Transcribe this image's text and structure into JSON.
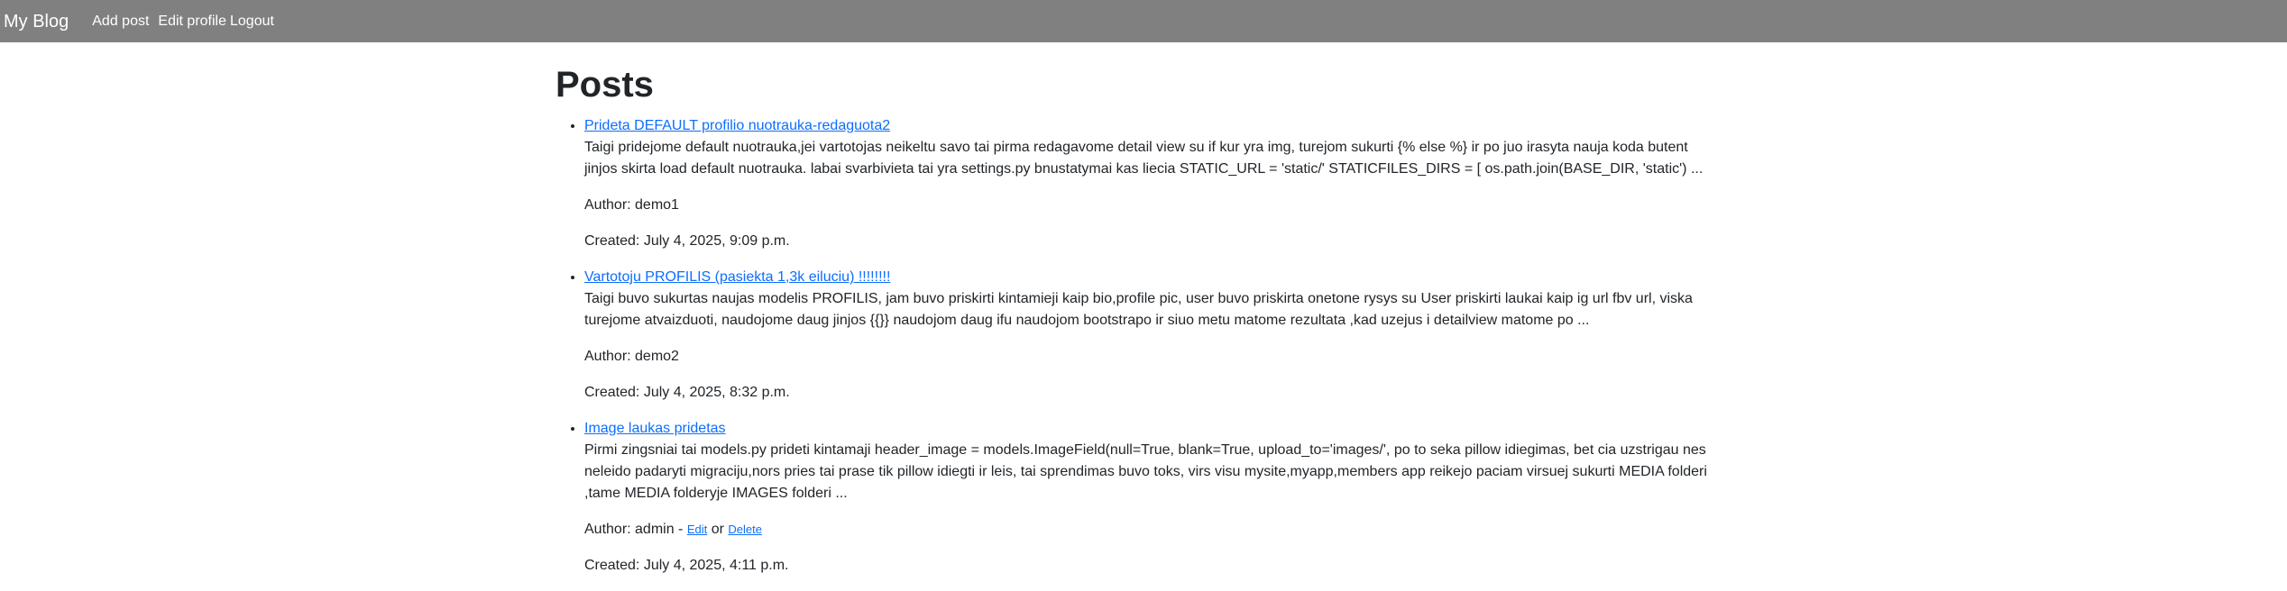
{
  "navbar": {
    "brand": "My Blog",
    "links": [
      "Add post",
      "Edit profile",
      "Logout"
    ]
  },
  "page": {
    "title": "Posts"
  },
  "posts": [
    {
      "title": "Prideta DEFAULT profilio nuotrauka-redaguota2",
      "body": "Taigi pridejome default nuotrauka,jei vartotojas neikeltu savo tai pirma redagavome detail view su if kur yra img, turejom sukurti {% else %} ir po juo irasyta nauja koda butent jinjos skirta load default nuotrauka. labai svarbivieta tai yra settings.py bnustatymai kas liecia STATIC_URL = 'static/' STATICFILES_DIRS = [ os.path.join(BASE_DIR, 'static') ...",
      "author": "Author: demo1",
      "created": "Created: July 4, 2025, 9:09 p.m."
    },
    {
      "title": "Vartotoju PROFILIS (pasiekta 1,3k eiluciu) !!!!!!!!",
      "body": "Taigi buvo sukurtas naujas modelis PROFILIS, jam buvo priskirti kintamieji kaip bio,profile pic, user buvo priskirta onetone rysys su User priskirti laukai kaip ig url fbv url, viska turejome atvaizduoti, naudojome daug jinjos {{}} naudojom daug ifu naudojom bootstrapo ir siuo metu matome rezultata ,kad uzejus i detailview matome po ...",
      "author": "Author: demo2",
      "created": "Created: July 4, 2025, 8:32 p.m."
    },
    {
      "title": "Image laukas pridetas",
      "body": "Pirmi zingsniai tai models.py prideti kintamaji header_image = models.ImageField(null=True, blank=True, upload_to='images/', po to seka pillow idiegimas, bet cia uzstrigau nes neleido padaryti migraciju,nors pries tai prase tik pillow idiegti ir leis, tai sprendimas buvo toks, virs visu mysite,myapp,members app reikejo paciam virsuej sukurti MEDIA folderi ,tame MEDIA folderyje IMAGES folderi ...",
      "author_prefix": "Author: admin - ",
      "edit_label": "Edit",
      "or_label": "or",
      "delete_label": "Delete",
      "created": "Created: July 4, 2025, 4:11 p.m."
    }
  ]
}
